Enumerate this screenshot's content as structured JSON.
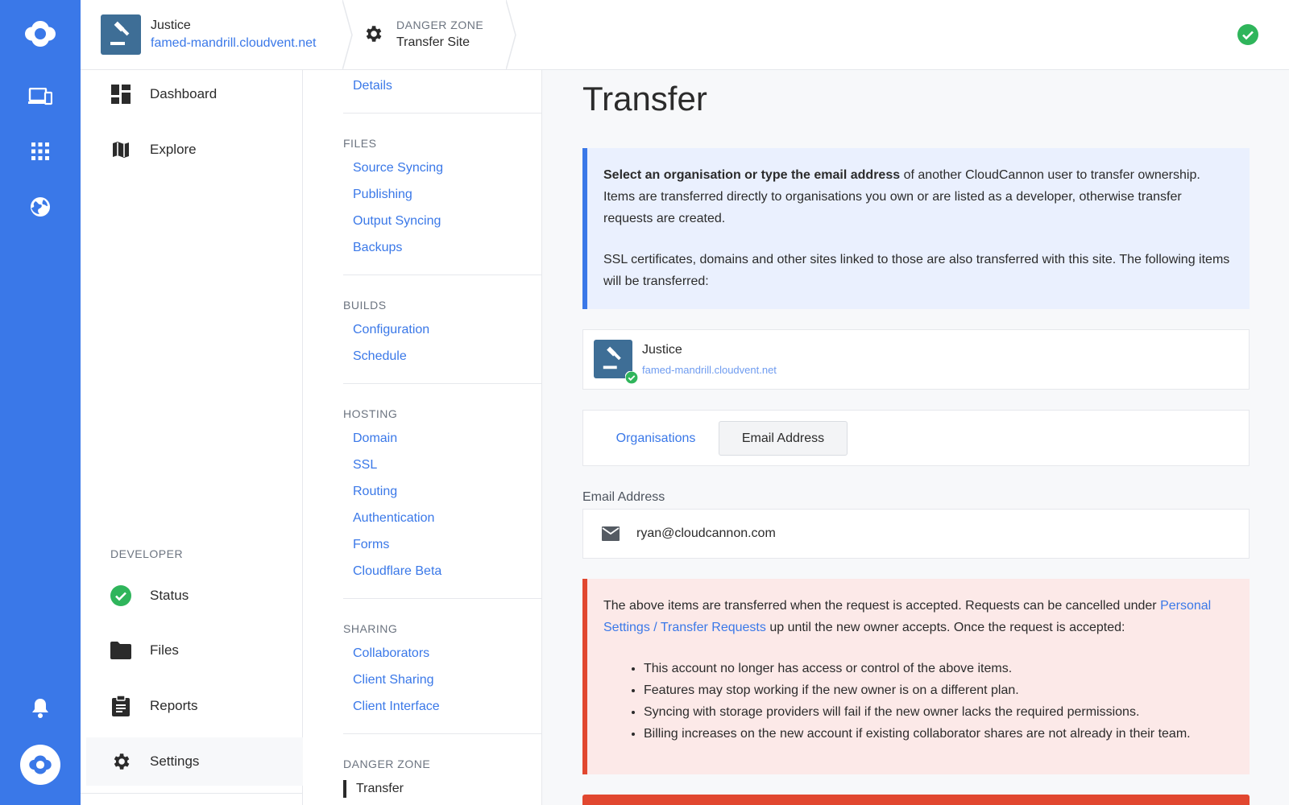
{
  "header": {
    "site_name": "Justice",
    "site_url": "famed-mandrill.cloudvent.net",
    "section_label": "DANGER ZONE",
    "section_title": "Transfer Site"
  },
  "sidebar": {
    "items_top": [
      {
        "label": "Dashboard",
        "icon": "dashboard-icon"
      },
      {
        "label": "Explore",
        "icon": "map-icon"
      }
    ],
    "developer_heading": "DEVELOPER",
    "items_dev": [
      {
        "label": "Status",
        "icon": "check-circle-icon"
      },
      {
        "label": "Files",
        "icon": "folder-icon"
      },
      {
        "label": "Reports",
        "icon": "clipboard-icon"
      },
      {
        "label": "Settings",
        "icon": "gear-icon"
      }
    ]
  },
  "subnav": {
    "details": "Details",
    "files_heading": "FILES",
    "files": [
      "Source Syncing",
      "Publishing",
      "Output Syncing",
      "Backups"
    ],
    "builds_heading": "BUILDS",
    "builds": [
      "Configuration",
      "Schedule"
    ],
    "hosting_heading": "HOSTING",
    "hosting": [
      "Domain",
      "SSL",
      "Routing",
      "Authentication",
      "Forms",
      "Cloudflare Beta"
    ],
    "sharing_heading": "SHARING",
    "sharing": [
      "Collaborators",
      "Client Sharing",
      "Client Interface"
    ],
    "danger_heading": "DANGER ZONE",
    "danger_current": "Transfer"
  },
  "main": {
    "title": "Transfer",
    "info_bold": "Select an organisation or type the email address",
    "info_rest": " of another CloudCannon user to transfer ownership. Items are transferred directly to organisations you own or are listed as a developer, otherwise transfer requests are created.",
    "info_p2": "SSL certificates, domains and other sites linked to those are also transferred with this site. The following items will be transferred:",
    "item_name": "Justice",
    "item_url": "famed-mandrill.cloudvent.net",
    "tab_org": "Organisations",
    "tab_email": "Email Address",
    "email_label": "Email Address",
    "email_value": "ryan@cloudcannon.com",
    "warn_p1_a": "The above items are transferred when the request is accepted. Requests can be cancelled under ",
    "warn_link": "Personal Settings / Transfer Requests",
    "warn_p1_b": " up until the new owner accepts. Once the request is accepted:",
    "warn_list": [
      "This account no longer has access or control of the above items.",
      "Features may stop working if the new owner is on a different plan.",
      "Syncing with storage providers will fail if the new owner lacks the required permissions.",
      "Billing increases on the new account if existing collaborator shares are not already in their team."
    ]
  },
  "colors": {
    "brand": "#3a78e8",
    "success": "#2fb55b",
    "danger": "#e1472f"
  }
}
